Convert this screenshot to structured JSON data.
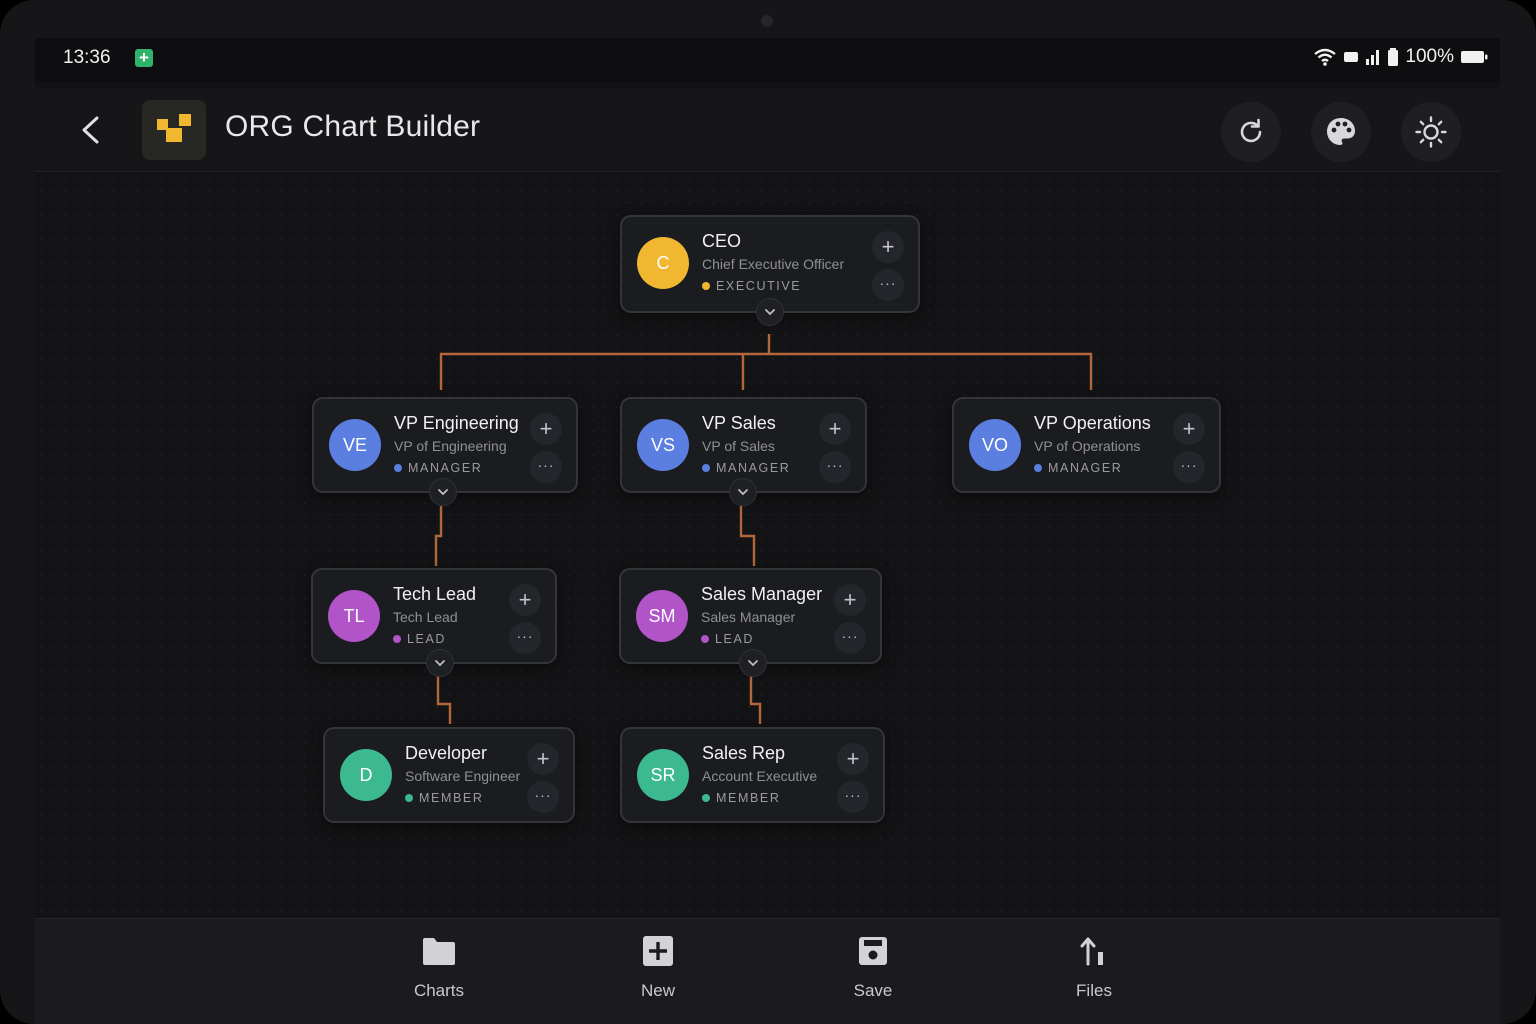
{
  "status_bar": {
    "time": "13:36",
    "battery": "100%"
  },
  "header": {
    "title": "ORG Chart Builder",
    "actions": [
      {
        "name": "refresh",
        "icon": "refresh-icon"
      },
      {
        "name": "theme-colors",
        "icon": "palette-icon"
      },
      {
        "name": "light-mode",
        "icon": "sun-icon"
      }
    ]
  },
  "level_colors": {
    "executive": "#f1b731",
    "manager": "#5b7fe0",
    "lead": "#b154c7",
    "member": "#3cb98f",
    "connector": "#b3663a"
  },
  "org": {
    "ceo": {
      "initials": "C",
      "title": "CEO",
      "subtitle": "Chief Executive Officer",
      "level": "EXECUTIVE"
    },
    "vp_engineering": {
      "initials": "VE",
      "title": "VP Engineering",
      "subtitle": "VP of Engineering",
      "level": "MANAGER"
    },
    "vp_sales": {
      "initials": "VS",
      "title": "VP Sales",
      "subtitle": "VP of Sales",
      "level": "MANAGER"
    },
    "vp_operations": {
      "initials": "VO",
      "title": "VP Operations",
      "subtitle": "VP of Operations",
      "level": "MANAGER"
    },
    "tech_lead": {
      "initials": "TL",
      "title": "Tech Lead",
      "subtitle": "Tech Lead",
      "level": "LEAD"
    },
    "sales_manager": {
      "initials": "SM",
      "title": "Sales Manager",
      "subtitle": "Sales Manager",
      "level": "LEAD"
    },
    "developer": {
      "initials": "D",
      "title": "Developer",
      "subtitle": "Software Engineer",
      "level": "MEMBER"
    },
    "sales_rep": {
      "initials": "SR",
      "title": "Sales Rep",
      "subtitle": "Account Executive",
      "level": "MEMBER"
    }
  },
  "node_actions": {
    "add_symbol": "+",
    "more_symbol": "···"
  },
  "bottom_nav": [
    {
      "label": "Charts",
      "icon": "folder-icon"
    },
    {
      "label": "New",
      "icon": "add-box-icon"
    },
    {
      "label": "Save",
      "icon": "save-icon"
    },
    {
      "label": "Files",
      "icon": "upload-icon"
    }
  ]
}
